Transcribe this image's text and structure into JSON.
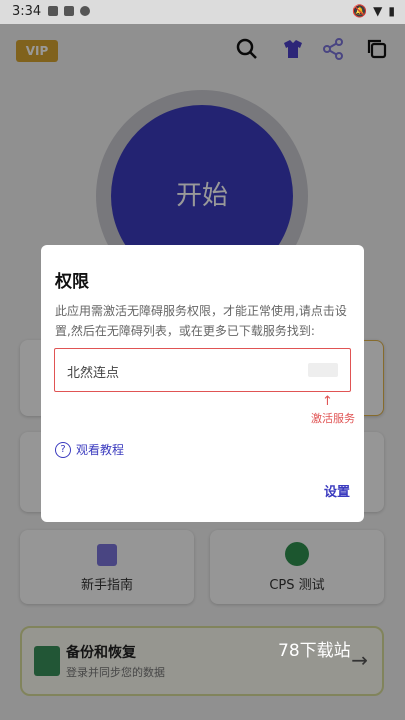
{
  "status_bar": {
    "time": "3:34"
  },
  "header": {
    "vip_label": "VIP",
    "icons": [
      "search-icon",
      "shirt-icon",
      "share-icon",
      "copy-icon"
    ]
  },
  "start_button": {
    "label": "开始"
  },
  "cards": [
    {
      "label": "新手指南",
      "icon": "guide-icon"
    },
    {
      "label": "CPS 测试",
      "icon": "gauge-icon"
    }
  ],
  "backup": {
    "title": "备份和恢复",
    "subtitle": "登录并同步您的数据"
  },
  "dialog": {
    "title": "权限",
    "message": "此应用需激活无障碍服务权限，才能正常使用,请点击设置,然后在无障碍列表，或在更多已下载服务找到:",
    "service_name": "北然连点",
    "arrow": "↑",
    "activate_hint": "激活服务",
    "tutorial_label": "观看教程",
    "settings_label": "设置"
  },
  "watermark": "78下载站",
  "colors": {
    "accent": "#3b3bbf",
    "warning": "#e05454",
    "vip": "#d6a431"
  }
}
